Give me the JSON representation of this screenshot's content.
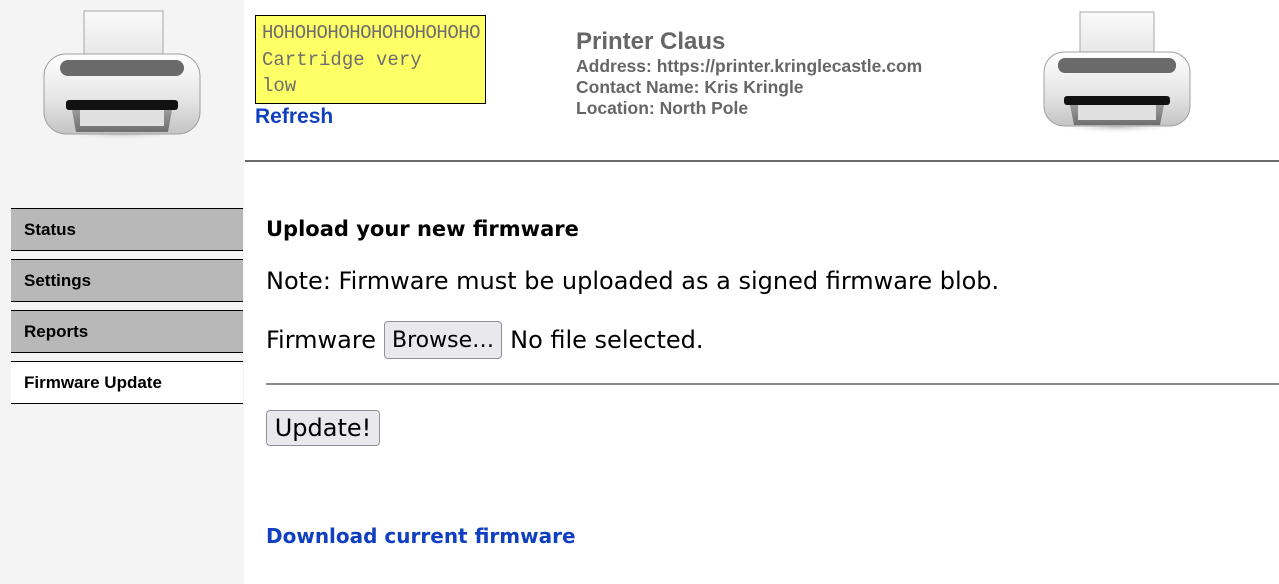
{
  "lcd": {
    "line1": "HOHOHOHOHOHOHOHOHOHO",
    "line2": "Cartridge very low"
  },
  "header": {
    "refresh_label": "Refresh",
    "printer_name": "Printer Claus",
    "address": "Address: https://printer.kringlecastle.com",
    "contact": "Contact Name: Kris Kringle",
    "location": "Location: North Pole"
  },
  "sidebar": {
    "logo_icon": "printer-icon",
    "items": [
      {
        "label": "Status",
        "active": false
      },
      {
        "label": "Settings",
        "active": false
      },
      {
        "label": "Reports",
        "active": false
      },
      {
        "label": "Firmware Update",
        "active": true
      }
    ]
  },
  "main": {
    "title": "Upload your new firmware",
    "note": "Note: Firmware must be uploaded as a signed firmware blob.",
    "firmware_label": "Firmware",
    "browse_label": "Browse…",
    "file_status": "No file selected.",
    "update_label": "Update!",
    "download_label": "Download current firmware"
  },
  "colors": {
    "lcd_background": "#ffff66",
    "link": "#1040c0",
    "nav_inactive": "#b8b8b8",
    "sidebar_background": "#f4f4f4"
  }
}
